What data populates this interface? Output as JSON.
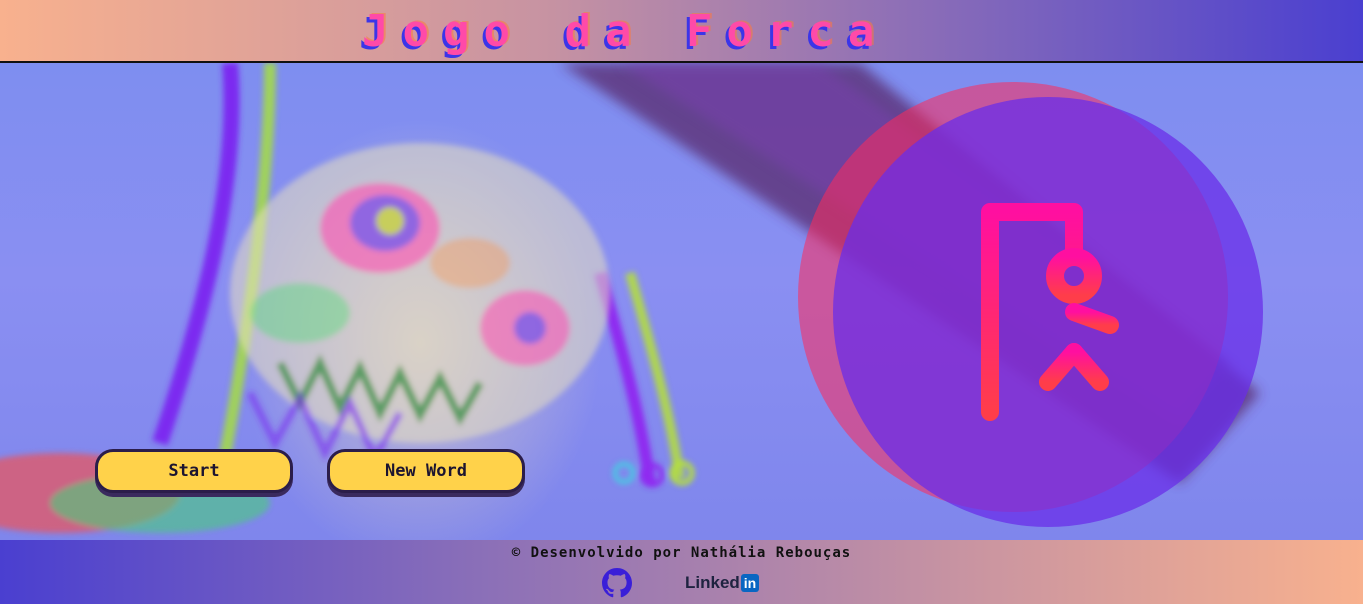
{
  "header": {
    "title": "Jogo da Forca"
  },
  "actions": {
    "start_label": "Start",
    "new_word_label": "New Word"
  },
  "footer": {
    "credit": "© Desenvolvido por Nathália Rebouças",
    "github_icon": "github-icon",
    "linkedin_text": "Linked",
    "linkedin_box": "in"
  },
  "colors": {
    "accent_button": "#ffd24a",
    "title_pink": "#ff4aa8",
    "logo_circle": "#6a2ee8",
    "logo_gradient_top": "#ff0fa0",
    "logo_gradient_bottom": "#ff3d4a"
  }
}
